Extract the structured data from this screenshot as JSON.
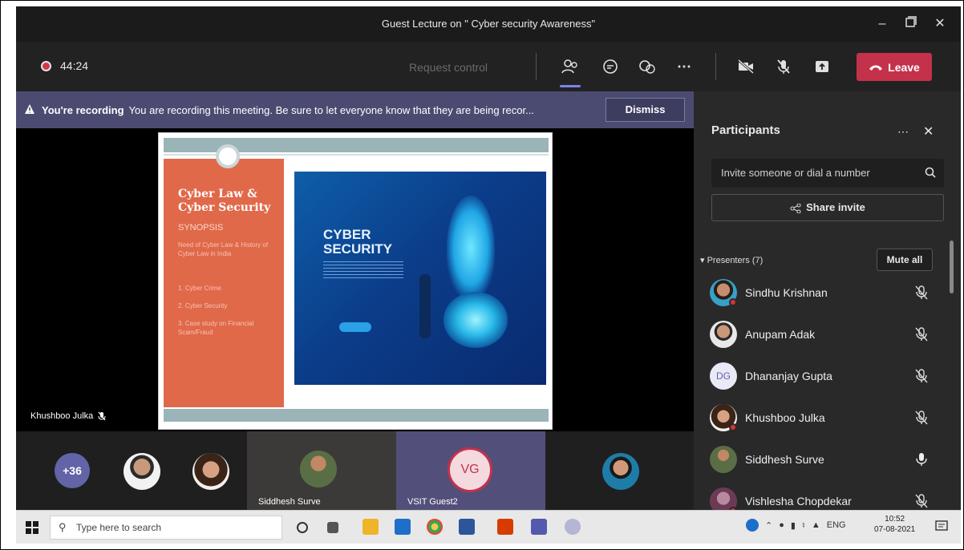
{
  "window": {
    "title": "Guest Lecture on \" Cyber security Awareness\""
  },
  "controls": {
    "timer": "44:24",
    "request_control": "Request control",
    "leave_label": "Leave"
  },
  "banner": {
    "bold": "You're recording",
    "text": "You are recording this meeting. Be sure to let everyone know that they are being recor...",
    "dismiss": "Dismiss"
  },
  "slide": {
    "title_line1": "Cyber Law &",
    "title_line2": "Cyber Security",
    "synopsis": "SYNOPSIS",
    "need": "Need of Cyber Law & History of Cyber Law in India",
    "items": [
      "1.  Cyber Crime",
      "2.  Cyber Security",
      "3.  Case study on Financial Scam/Fraud"
    ],
    "cyber_line1": "CYBER",
    "cyber_line2": "SECURITY"
  },
  "stage": {
    "speaker": "Khushboo Julka"
  },
  "gallery": {
    "overflow": "+36",
    "tile_names": [
      "Siddhesh Surve",
      "VSIT Guest2"
    ],
    "vg_initials": "VG"
  },
  "participants": {
    "title": "Participants",
    "invite_placeholder": "Invite someone or dial a number",
    "share_invite": "Share invite",
    "presenters_label": "Presenters (7)",
    "mute_all": "Mute all",
    "people": [
      {
        "name": "Sindhu Krishnan",
        "initials": ""
      },
      {
        "name": "Anupam Adak",
        "initials": ""
      },
      {
        "name": "Dhananjay Gupta",
        "initials": "DG"
      },
      {
        "name": "Khushboo Julka",
        "initials": ""
      },
      {
        "name": "Siddhesh Surve",
        "initials": ""
      },
      {
        "name": "Vishlesha Chopdekar",
        "initials": ""
      }
    ]
  },
  "taskbar": {
    "search_placeholder": "Type here to search",
    "lang": "ENG",
    "time": "10:52",
    "date": "07-08-2021"
  },
  "colors": {
    "accent": "#7b83eb",
    "leave": "#c4314b",
    "banner": "#4b4b72",
    "slide_orange": "#e0694a"
  }
}
